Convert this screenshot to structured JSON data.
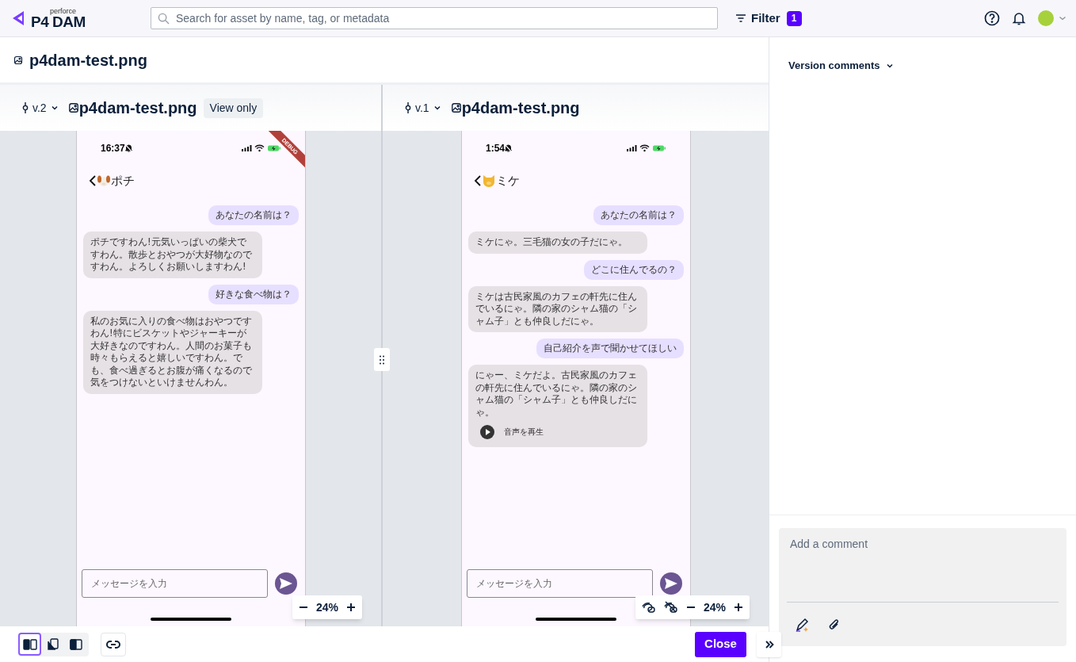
{
  "brand": {
    "small": "perforce",
    "name": "P4 DAM"
  },
  "search": {
    "placeholder": "Search for asset by name, tag, or metadata"
  },
  "filter": {
    "label": "Filter",
    "count": "1"
  },
  "asset_title": "p4dam-test.png",
  "panes": [
    {
      "version": "v.2",
      "file": "p4dam-test.png",
      "badge": "View only",
      "zoom": "24%",
      "comment_toggles": false,
      "phone": {
        "time": "16:37",
        "ribbon": "DEBUG",
        "kind": "dog",
        "contact": "ポチ",
        "input_placeholder": "メッセージを入力",
        "messages": [
          {
            "kind": "user",
            "text": "あなたの名前は？"
          },
          {
            "kind": "bot",
            "text": "ポチですわん!元気いっぱいの柴犬ですわん。散歩とおやつが大好物なのですわん。よろしくお願いしますわん!"
          },
          {
            "kind": "user",
            "text": "好きな食べ物は？"
          },
          {
            "kind": "bot",
            "text": "私のお気に入りの食べ物はおやつですわん!特にビスケットやジャーキーが大好きなのですわん。人間のお菓子も時々もらえると嬉しいですわん。でも、食べ過ぎるとお腹が痛くなるので気をつけないといけませんわん。"
          }
        ]
      }
    },
    {
      "version": "v.1",
      "file": "p4dam-test.png",
      "zoom": "24%",
      "comment_toggles": true,
      "phone": {
        "time": "1:54",
        "kind": "cat",
        "contact": "ミケ",
        "input_placeholder": "メッセージを入力",
        "messages": [
          {
            "kind": "user",
            "text": "あなたの名前は？"
          },
          {
            "kind": "bot",
            "text": "ミケにゃ。三毛猫の女の子だにゃ。"
          },
          {
            "kind": "user",
            "text": "どこに住んでるの？"
          },
          {
            "kind": "bot",
            "text": "ミケは古民家風のカフェの軒先に住んでいるにゃ。隣の家のシャム猫の「シャム子」とも仲良しだにゃ。"
          },
          {
            "kind": "user",
            "text": "自己紹介を声で聞かせてほしい"
          },
          {
            "kind": "bot",
            "text": "にゃー、ミケだよ。古民家風のカフェの軒先に住んでいるにゃ。隣の家のシャム猫の「シャム子」とも仲良しだにゃ。",
            "audio_label": "音声を再生"
          }
        ]
      }
    }
  ],
  "view_modes": [
    {
      "selected": true
    },
    {
      "selected": false
    },
    {
      "selected": false
    }
  ],
  "close": "Close",
  "comments": {
    "title": "Version comments",
    "placeholder": "Add a comment"
  }
}
